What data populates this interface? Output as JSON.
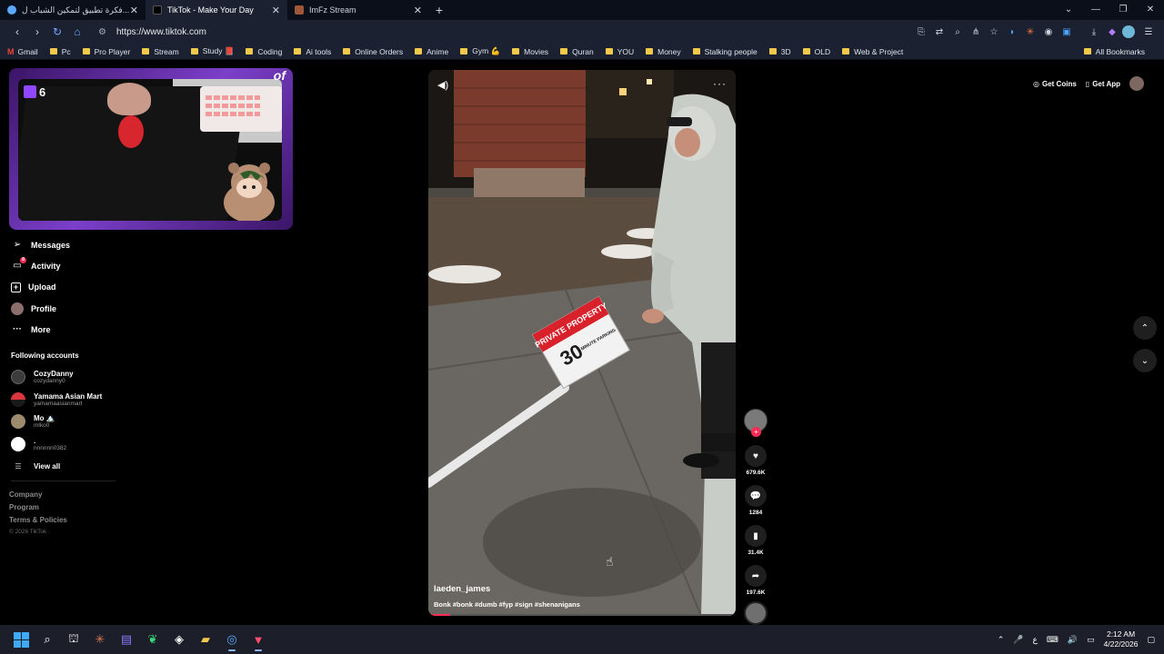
{
  "tabs": [
    {
      "title": "فكرة تطبيق لتمكين الشباب ل...",
      "icon": "gemini-icon"
    },
    {
      "title": "TikTok - Make Your Day",
      "icon": "tiktok-icon"
    },
    {
      "title": "ImFz Stream",
      "icon": "stream-icon"
    }
  ],
  "address": {
    "url": "https://www.tiktok.com"
  },
  "bookmarks": [
    "Gmail",
    "Pc",
    "Pro Player",
    "Stream",
    "Study 📕",
    "Coding",
    "Ai tools",
    "Online Orders",
    "Anime",
    "Gym 💪",
    "Movies",
    "Quran",
    "YOU",
    "Money",
    "Stalking people",
    "3D",
    "OLD",
    "Web & Project"
  ],
  "bookmarks_all": "All Bookmarks",
  "stream": {
    "viewer_count": "6",
    "deco_text": "of"
  },
  "nav": {
    "messages": "Messages",
    "activity": "Activity",
    "activity_badge": "8",
    "upload": "Upload",
    "profile": "Profile",
    "more": "More"
  },
  "following": {
    "title": "Following accounts",
    "accounts": [
      {
        "name": "CozyDanny",
        "handle": "cozydanny0"
      },
      {
        "name": "Yamama Asian Mart",
        "handle": "yamamaasianmart"
      },
      {
        "name": "Mo 🏔️",
        "handle": "mlko0"
      },
      {
        "name": ".",
        "handle": "nnnnnn0382"
      }
    ],
    "view_all": "View all"
  },
  "footer": {
    "company": "Company",
    "program": "Program",
    "terms": "Terms & Policies",
    "copyright": "© 2026 TikTok"
  },
  "top_right": {
    "get_coins": "Get Coins",
    "get_app": "Get App"
  },
  "video": {
    "author": "laeden_james",
    "caption": "Bonk #bonk #dumb #fyp #sign #shenanigans",
    "sign_top": "PRIVATE PROPERTY",
    "sign_number": "30",
    "sign_small": "MINUTE PARKING",
    "progress": 0.07
  },
  "actions": {
    "likes": "679.6K",
    "comments": "1284",
    "saves": "31.4K",
    "shares": "197.6K"
  },
  "clock": {
    "time": "2:12 AM",
    "date": "4/22/2026"
  },
  "tray": {
    "lang": "ع"
  }
}
